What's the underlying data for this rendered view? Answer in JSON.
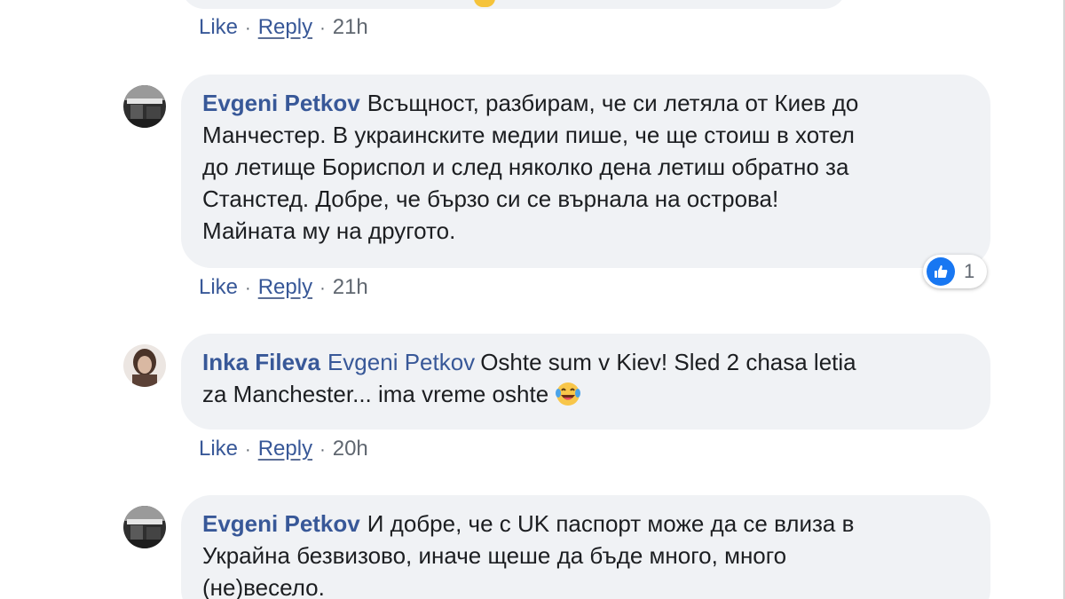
{
  "comments": [
    {
      "actions": {
        "like": "Like",
        "reply": "Reply",
        "time": "21h"
      }
    },
    {
      "author": "Evgeni Petkov",
      "line1": "Всъщност, разбирам, че си летяла от Киев до",
      "line2": "Манчестер. В украинските медии пише, че ще стоиш в хотел",
      "line3": "до летище Бориспол и след няколко дена летиш обратно за",
      "line4": "Станстед. Добре, че бързо си се върнала на острова!",
      "line5": "Майната му на другото.",
      "reaction": {
        "icon": "like-icon",
        "count": "1"
      },
      "actions": {
        "like": "Like",
        "reply": "Reply",
        "time": "21h"
      }
    },
    {
      "author": "Inka Fileva",
      "mention": "Evgeni Petkov",
      "line1": "Oshte sum v Kiev! Sled 2 chasa letia",
      "line2": "za Manchester... ima vreme oshte",
      "emoji": "face-with-tears-of-joy",
      "actions": {
        "like": "Like",
        "reply": "Reply",
        "time": "20h"
      }
    },
    {
      "author": "Evgeni Petkov",
      "line1": "И добре, че с UK паспорт може да се влиза в",
      "line2": "Украйна безвизово, иначе щеше да бъде много, много",
      "line3": "(не)весело."
    }
  ],
  "colors": {
    "link": "#385898",
    "bubble": "#f0f2f5",
    "text": "#1c1e21",
    "meta": "#606770",
    "like_blue": "#1877f2"
  }
}
